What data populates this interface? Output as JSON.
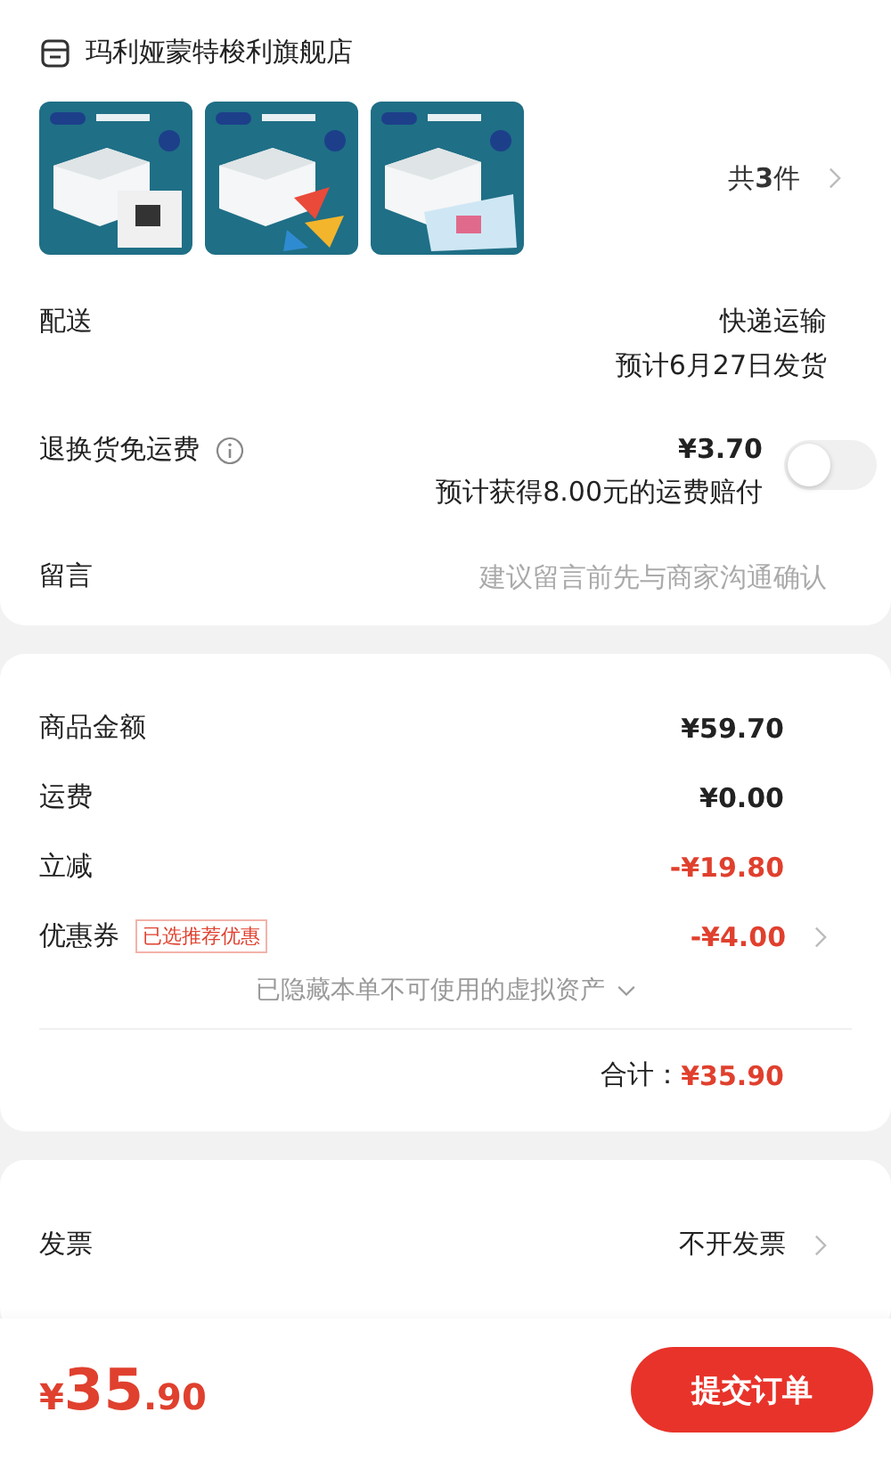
{
  "store": {
    "name": "玛利娅蒙特梭利旗舰店"
  },
  "products": {
    "count_label": "共**3**件"
  },
  "delivery": {
    "label": "配送",
    "method": "快递运输",
    "estimate": "预计6月27日发货"
  },
  "return_insurance": {
    "label": "退换货免运费",
    "price": "¥3.70",
    "note": "预计获得8.00元的运费赔付",
    "on": false
  },
  "message": {
    "label": "留言",
    "placeholder": "建议留言前先与商家沟通确认"
  },
  "summary": {
    "rows": [
      {
        "label": "商品金额",
        "value": "¥59.70",
        "kind": "plain"
      },
      {
        "label": "运费",
        "value": "¥0.00",
        "kind": "plain"
      },
      {
        "label": "立减",
        "value": "-¥19.80",
        "kind": "discount"
      },
      {
        "label": "优惠券",
        "tag": "已选推荐优惠",
        "value": "-¥4.00",
        "kind": "discount_link"
      }
    ],
    "hidden_note": "已隐藏本单不可使用的虚拟资产",
    "total_label": "合计：",
    "total": "¥35.90"
  },
  "invoice": {
    "label": "发票",
    "value": "不开发票"
  },
  "footer": {
    "price_symbol": "¥",
    "price_main": "35",
    "price_decimal": ".90",
    "submit": "提交订单"
  }
}
